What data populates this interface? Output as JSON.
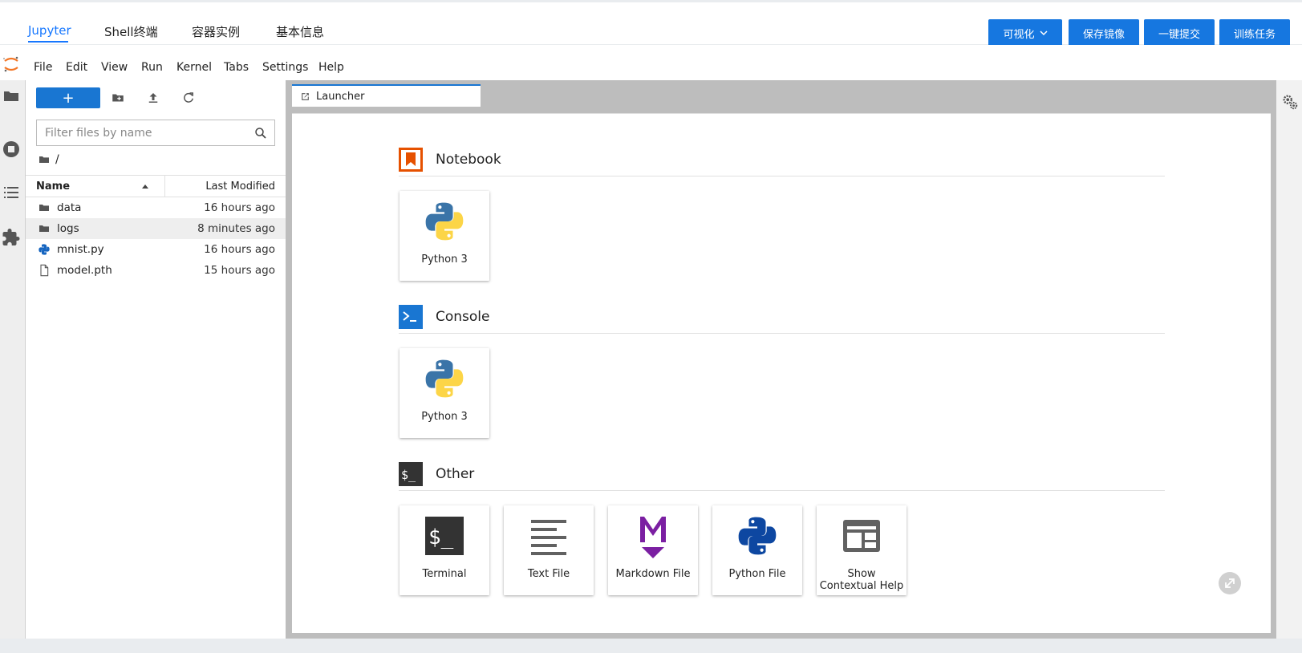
{
  "topnav": {
    "tabs": [
      "Jupyter",
      "Shell终端",
      "容器实例",
      "基本信息"
    ],
    "buttons": [
      "可视化",
      "保存镜像",
      "一键提交",
      "训练任务"
    ]
  },
  "menubar": {
    "items": [
      "File",
      "Edit",
      "View",
      "Run",
      "Kernel",
      "Tabs",
      "Settings",
      "Help"
    ]
  },
  "activity_icons": [
    "folder-icon",
    "running-icon",
    "toc-icon",
    "extension-icon"
  ],
  "filebrowser": {
    "new_label": "+",
    "filter_placeholder": "Filter files by name",
    "breadcrumb": "/",
    "header": {
      "name": "Name",
      "modified": "Last Modified"
    },
    "files": [
      {
        "name": "data",
        "modified": "16 hours ago",
        "type": "folder"
      },
      {
        "name": "logs",
        "modified": "8 minutes ago",
        "type": "folder"
      },
      {
        "name": "mnist.py",
        "modified": "16 hours ago",
        "type": "python"
      },
      {
        "name": "model.pth",
        "modified": "15 hours ago",
        "type": "file"
      }
    ]
  },
  "tab": {
    "label": "Launcher"
  },
  "launcher": {
    "notebook": {
      "title": "Notebook",
      "items": [
        "Python 3"
      ]
    },
    "console": {
      "title": "Console",
      "items": [
        "Python 3"
      ]
    },
    "other": {
      "title": "Other",
      "items": [
        "Terminal",
        "Text File",
        "Markdown File",
        "Python File",
        "Show Contextual Help"
      ]
    }
  },
  "colors": {
    "accent": "#1976d2",
    "nav_active": "#1677ff",
    "notebook_icon": "#e65100",
    "console_icon": "#1976d2",
    "markdown_icon": "#7b1fa2",
    "dark_icon": "#333333"
  }
}
